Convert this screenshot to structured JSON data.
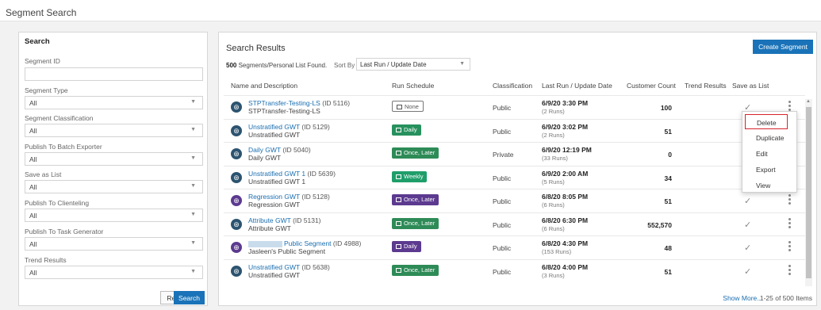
{
  "page": {
    "title": "Segment Search"
  },
  "search": {
    "header": "Search",
    "fields": [
      {
        "label": "Segment ID",
        "value": "",
        "type": "text"
      },
      {
        "label": "Segment Type",
        "value": "All",
        "type": "select"
      },
      {
        "label": "Segment Classification",
        "value": "All",
        "type": "select"
      },
      {
        "label": "Publish To Batch Exporter",
        "value": "All",
        "type": "select"
      },
      {
        "label": "Save as List",
        "value": "All",
        "type": "select"
      },
      {
        "label": "Publish To Clienteling",
        "value": "All",
        "type": "select"
      },
      {
        "label": "Publish To Task Generator",
        "value": "All",
        "type": "select"
      },
      {
        "label": "Trend Results",
        "value": "All",
        "type": "select"
      }
    ],
    "reset_label": "Reset",
    "search_label": "Search"
  },
  "results": {
    "title": "Search Results",
    "create_label": "Create Segment",
    "found_count": "500",
    "found_text": "Segments/Personal List Found.",
    "sort_label": "Sort By",
    "sort_value": "Last Run / Update Date",
    "columns": {
      "name": "Name and Description",
      "schedule": "Run Schedule",
      "classification": "Classification",
      "last_run": "Last Run / Update Date",
      "customer_count": "Customer Count",
      "trend": "Trend Results",
      "save_list": "Save as List"
    },
    "rows": [
      {
        "name": "STPTransfer-Testing-LS",
        "id": "(ID 5116)",
        "desc": "STPTransfer-Testing-LS",
        "schedule": "None",
        "class": "Public",
        "date": "6/9/20 3:30 PM",
        "runs": "(2 Runs)",
        "count": "100"
      },
      {
        "name": "Unstratified GWT",
        "id": "(ID 5129)",
        "desc": "Unstratified GWT",
        "schedule": "Daily",
        "class": "Public",
        "date": "6/9/20 3:02 PM",
        "runs": "(2 Runs)",
        "count": "51"
      },
      {
        "name": "Daily GWT",
        "id": "(ID 5040)",
        "desc": "Daily GWT",
        "schedule": "Once, Later",
        "class": "Private",
        "date": "6/9/20 12:19 PM",
        "runs": "(33 Runs)",
        "count": "0"
      },
      {
        "name": "Unstratified GWT 1",
        "id": "(ID 5639)",
        "desc": "Unstratified GWT 1",
        "schedule": "Weekly",
        "class": "Public",
        "date": "6/9/20 2:00 AM",
        "runs": "(5 Runs)",
        "count": "34"
      },
      {
        "name": "Regression GWT",
        "id": "(ID 5128)",
        "desc": "Regression GWT",
        "schedule": "Once, Later",
        "class": "Public",
        "date": "6/8/20 8:05 PM",
        "runs": "(6 Runs)",
        "count": "51"
      },
      {
        "name": "Attribute GWT",
        "id": "(ID 5131)",
        "desc": "Attribute GWT",
        "schedule": "Once, Later",
        "class": "Public",
        "date": "6/8/20 6:30 PM",
        "runs": "(6 Runs)",
        "count": "552,570"
      },
      {
        "name": "Public Segment",
        "id": "(ID 4988)",
        "desc": "Jasleen's Public Segment",
        "schedule": "Daily",
        "class": "Public",
        "date": "6/8/20 4:30 PM",
        "runs": "(153 Runs)",
        "count": "48"
      },
      {
        "name": "Unstratified GWT",
        "id": "(ID 5638)",
        "desc": "Unstratified GWT",
        "schedule": "Once, Later",
        "class": "Public",
        "date": "6/8/20 4:00 PM",
        "runs": "(3 Runs)",
        "count": "51"
      }
    ],
    "show_more": "Show More..",
    "paging": "1-25 of 500 Items"
  },
  "context_menu": {
    "items": [
      "Delete",
      "Duplicate",
      "Edit",
      "Export",
      "View"
    ]
  },
  "colors": {
    "accent": "#1a73b8",
    "badge_green": "#27915e",
    "badge_purple": "#5c3a8f",
    "highlight": "#d6232a"
  }
}
